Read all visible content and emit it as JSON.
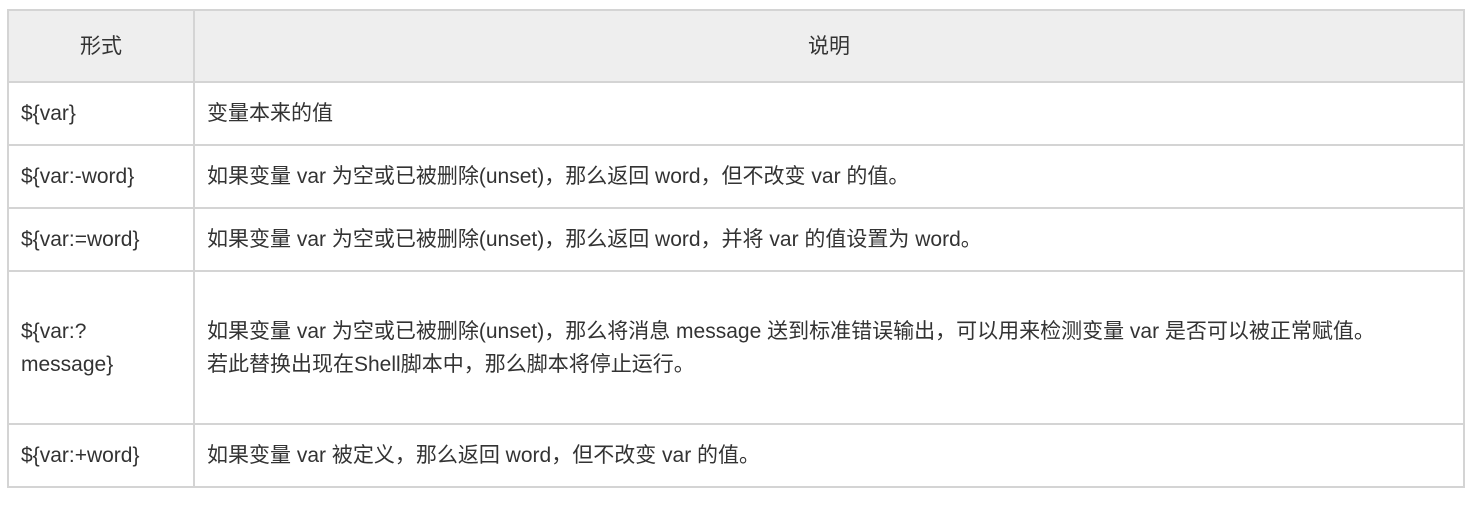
{
  "headers": [
    "形式",
    "说明"
  ],
  "rows": [
    {
      "form": "${var}",
      "desc": [
        "变量本来的值"
      ]
    },
    {
      "form": "${var:-word}",
      "desc": [
        "如果变量 var 为空或已被删除(unset)，那么返回 word，但不改变 var 的值。"
      ]
    },
    {
      "form": "${var:=word}",
      "desc": [
        "如果变量 var 为空或已被删除(unset)，那么返回 word，并将 var 的值设置为 word。"
      ]
    },
    {
      "form": "${var:? message}",
      "desc": [
        "如果变量 var 为空或已被删除(unset)，那么将消息 message 送到标准错误输出，可以用来检测变量 var 是否可以被正常赋值。",
        "若此替换出现在Shell脚本中，那么脚本将停止运行。"
      ]
    },
    {
      "form": "${var:+word}",
      "desc": [
        "如果变量 var 被定义，那么返回 word，但不改变 var 的值。"
      ]
    }
  ]
}
